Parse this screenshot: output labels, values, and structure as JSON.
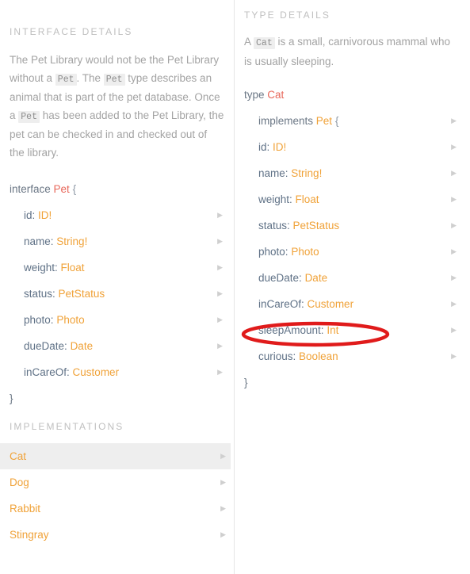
{
  "colors": {
    "type_name": "#e8685b",
    "interface_name": "#f0a238",
    "field_name": "#5f7186",
    "field_type": "#f0a238",
    "keyword": "#6b7785",
    "muted_text": "#a3a3a3",
    "section_title": "#bfbfbf",
    "selected_row_bg": "#eeeeee",
    "annotation": "#e01b1b",
    "divider": "#e6e6e6"
  },
  "left_panel": {
    "section_title": "INTERFACE DETAILS",
    "description": {
      "part1": "The Pet Library would not be the Pet Library without a ",
      "code1": "Pet",
      "part2": ". The ",
      "code2": "Pet",
      "part3": " type describes an animal that is part of the pet database. Once a ",
      "code3": "Pet",
      "part4": " has been added to the Pet Library, the pet can be checked in and checked out of the library."
    },
    "signature": {
      "keyword": "interface",
      "name": "Pet",
      "open_brace": "{"
    },
    "close_brace": "}",
    "fields": [
      {
        "name": "id:",
        "type": "ID!"
      },
      {
        "name": "name:",
        "type": "String!"
      },
      {
        "name": "weight:",
        "type": "Float"
      },
      {
        "name": "status:",
        "type": "PetStatus"
      },
      {
        "name": "photo:",
        "type": "Photo"
      },
      {
        "name": "dueDate:",
        "type": "Date"
      },
      {
        "name": "inCareOf:",
        "type": "Customer"
      }
    ],
    "implementations_title": "IMPLEMENTATIONS",
    "implementations": [
      {
        "label": "Cat",
        "selected": true
      },
      {
        "label": "Dog",
        "selected": false
      },
      {
        "label": "Rabbit",
        "selected": false
      },
      {
        "label": "Stingray",
        "selected": false
      }
    ]
  },
  "right_panel": {
    "section_title": "TYPE DETAILS",
    "description": {
      "part1": "A ",
      "code1": "Cat",
      "part2": " is a small, carnivorous mammal who is usually sleeping."
    },
    "signature": {
      "keyword": "type",
      "name": "Cat"
    },
    "implements": {
      "keyword": "implements",
      "name": "Pet",
      "open_brace": "{"
    },
    "close_brace": "}",
    "fields": [
      {
        "name": "id:",
        "type": "ID!"
      },
      {
        "name": "name:",
        "type": "String!"
      },
      {
        "name": "weight:",
        "type": "Float"
      },
      {
        "name": "status:",
        "type": "PetStatus"
      },
      {
        "name": "photo:",
        "type": "Photo"
      },
      {
        "name": "dueDate:",
        "type": "Date"
      },
      {
        "name": "inCareOf:",
        "type": "Customer"
      },
      {
        "name": "sleepAmount:",
        "type": "Int",
        "annotated": true
      },
      {
        "name": "curious:",
        "type": "Boolean"
      }
    ]
  },
  "annotation": {
    "shape": "ellipse",
    "target_field": "sleepAmount: Int",
    "color": "#e01b1b"
  },
  "icons": {
    "chevron_right": "▶"
  }
}
